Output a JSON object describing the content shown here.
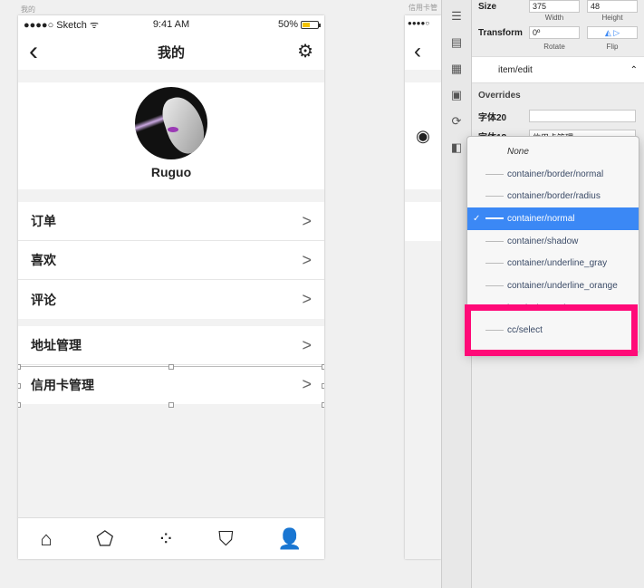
{
  "artboards": {
    "left_title": "我的",
    "right_title": "信用卡管"
  },
  "status_bar": {
    "carrier": "●●●●○ Sketch ᯤ",
    "time": "9:41 AM",
    "battery": "50%"
  },
  "nav": {
    "title": "我的",
    "back_icon": "‹",
    "settings_icon": "⚙"
  },
  "profile": {
    "username": "Ruguo"
  },
  "menu": {
    "group1": [
      "订单",
      "喜欢",
      "评论"
    ],
    "group2": [
      "地址管理",
      "信用卡管理"
    ],
    "chevron": ">"
  },
  "tabbar": {
    "icons": [
      "home-icon",
      "discover-icon",
      "apps-icon",
      "cart-icon",
      "profile-icon"
    ],
    "glyphs": [
      "⌂",
      "⬠",
      "⁘",
      "⛉",
      "👤"
    ]
  },
  "phone2": {
    "status": "●●●●○",
    "back": "‹",
    "radio": "◉"
  },
  "inspector": {
    "size_label": "Size",
    "width_value": "375",
    "height_value": "48",
    "width_label": "Width",
    "height_label": "Height",
    "transform_label": "Transform",
    "rotate_value": "0º",
    "rotate_label": "Rotate",
    "flip_label": "Flip",
    "symbol_name": "item/edit",
    "overrides_title": "Overrides",
    "override1_label": "字体20",
    "override2_label": "字体18",
    "override2_value": "信用卡管理"
  },
  "dropdown": {
    "items": [
      {
        "label": "None",
        "kind": "none"
      },
      {
        "label": "container/border/normal",
        "kind": "normal"
      },
      {
        "label": "container/border/radius",
        "kind": "normal"
      },
      {
        "label": "container/normal",
        "kind": "active",
        "check": "✓"
      },
      {
        "label": "container/shadow",
        "kind": "normal"
      },
      {
        "label": "container/underline_gray",
        "kind": "normal"
      },
      {
        "label": "container/underline_orange",
        "kind": "normal"
      },
      {
        "label": "header/normal",
        "kind": "normal"
      },
      {
        "label": "cc/select",
        "kind": "normal"
      }
    ]
  },
  "colors": {
    "highlight": "#ff0a78",
    "selection": "#3b88f5",
    "battery": "#f2c200"
  }
}
